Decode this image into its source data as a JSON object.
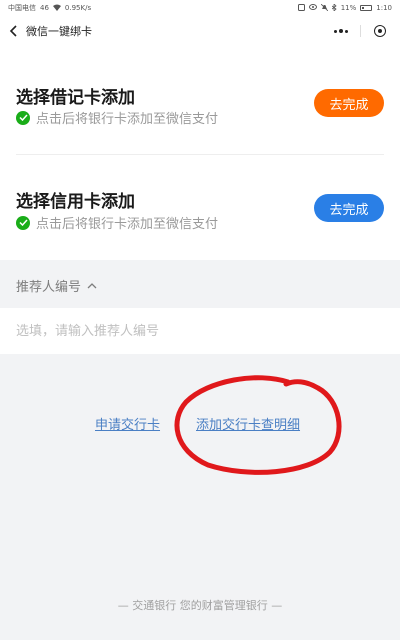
{
  "status_bar": {
    "carrier": "中国电信",
    "signal": "46",
    "net_speed": "0.95K/s",
    "battery": "11%",
    "time": "1:10"
  },
  "nav": {
    "title": "微信一键绑卡"
  },
  "cards": [
    {
      "title": "选择借记卡添加",
      "subtitle": "点击后将银行卡添加至微信支付",
      "button": "去完成",
      "button_color": "#ff6a00"
    },
    {
      "title": "选择信用卡添加",
      "subtitle": "点击后将银行卡添加至微信支付",
      "button": "去完成",
      "button_color": "#2a7fe6"
    }
  ],
  "referrer": {
    "label": "推荐人编号",
    "placeholder": "选填，请输入推荐人编号"
  },
  "links": {
    "apply": "申请交行卡",
    "query": "添加交行卡查明细"
  },
  "footer": "— 交通银行 您的财富管理银行 —",
  "colors": {
    "check_green": "#1aad19",
    "link_blue": "#4a7fc4",
    "annotation_red": "#e0181b"
  }
}
